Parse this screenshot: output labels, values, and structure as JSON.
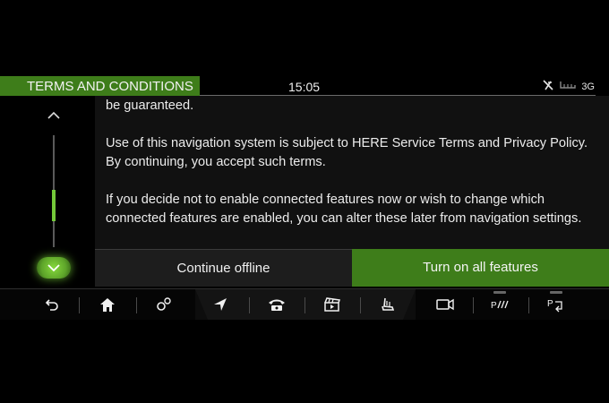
{
  "header": {
    "title": "TERMS AND CONDITIONS",
    "clock": "15:05",
    "signal": "3G"
  },
  "content": {
    "paragraphs": [
      "be guaranteed.",
      "Use of this navigation system is subject to HERE Service Terms and Privacy Policy. By continuing, you accept such terms.",
      "If you decide not to enable connected features now or wish to change which connected features are enabled, you can alter these later from navigation settings."
    ]
  },
  "buttons": {
    "offline": "Continue offline",
    "on": "Turn on all features"
  },
  "bottom_bar": {
    "items": [
      "back-icon",
      "home-icon",
      "settings-icon",
      "navigation-icon",
      "phone-icon",
      "media-icon",
      "seat-icon",
      "camera-icon",
      "park-assist-icon",
      "park-exit-icon"
    ]
  },
  "colors": {
    "accent": "#3e7d1a",
    "scroll_thumb": "#74c93a"
  }
}
